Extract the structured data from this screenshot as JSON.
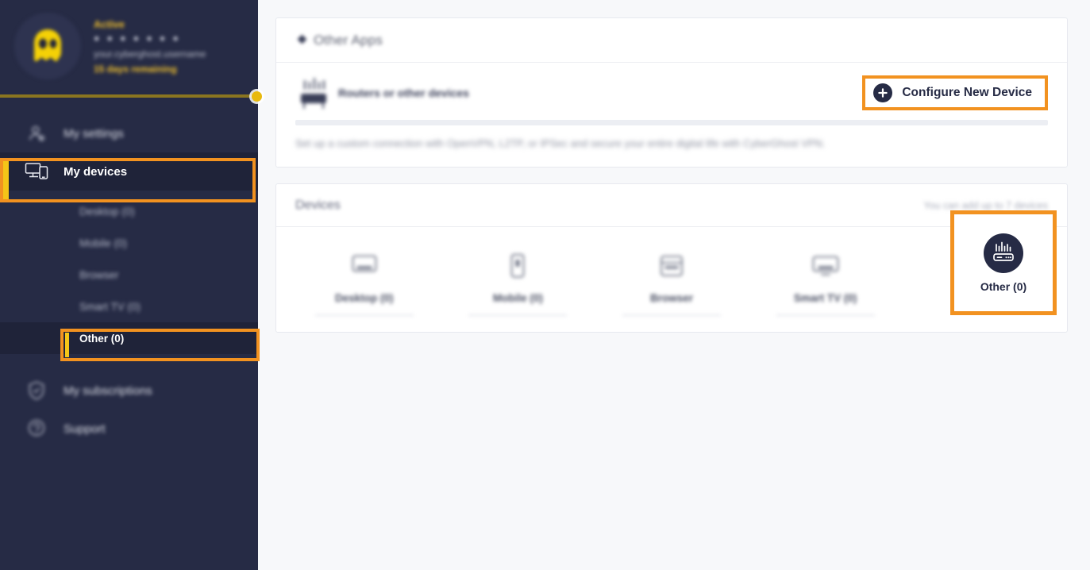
{
  "colors": {
    "accent_orange": "#f29220",
    "accent_yellow": "#f5c518",
    "sidebar_bg": "#262b45",
    "page_bg": "#f7f8fa",
    "card_bg": "#ffffff"
  },
  "sidebar": {
    "account": {
      "status": "Active",
      "masked_password": "● ● ● ● ● ● ●",
      "username": "your.cyberghost.username",
      "days_remaining": "15 days remaining"
    },
    "nav": [
      {
        "label": "My settings",
        "icon": "user-settings-icon",
        "active": false
      },
      {
        "label": "My devices",
        "icon": "devices-icon",
        "active": true
      },
      {
        "label": "My subscriptions",
        "icon": "shield-icon",
        "active": false
      },
      {
        "label": "Support",
        "icon": "chat-support-icon",
        "active": false
      }
    ],
    "sub_items": [
      {
        "label": "Desktop (0)",
        "active": false
      },
      {
        "label": "Mobile (0)",
        "active": false
      },
      {
        "label": "Browser",
        "active": false
      },
      {
        "label": "Smart TV (0)",
        "active": false
      },
      {
        "label": "Other (0)",
        "active": true
      }
    ]
  },
  "main": {
    "other_apps": {
      "title": "Other Apps",
      "icon": "diamond-icon"
    },
    "router_section": {
      "icon": "router-icon",
      "label": "Routers or other devices",
      "button": {
        "label": "Configure New Device",
        "icon": "plus-circle-icon"
      },
      "description": "Set up a custom connection with OpenVPN, L2TP, or IPSec and secure your entire digital life with CyberGhost VPN."
    },
    "devices": {
      "title": "Devices",
      "note": "You can add up to 7 devices",
      "tiles": [
        {
          "label": "Desktop (0)",
          "icon": "desktop-icon",
          "selected": false
        },
        {
          "label": "Mobile (0)",
          "icon": "mobile-icon",
          "selected": false
        },
        {
          "label": "Browser",
          "icon": "browser-icon",
          "selected": false
        },
        {
          "label": "Smart TV (0)",
          "icon": "smart-tv-icon",
          "selected": false
        },
        {
          "label": "Other (0)",
          "icon": "router-circle-icon",
          "selected": true
        }
      ]
    }
  }
}
